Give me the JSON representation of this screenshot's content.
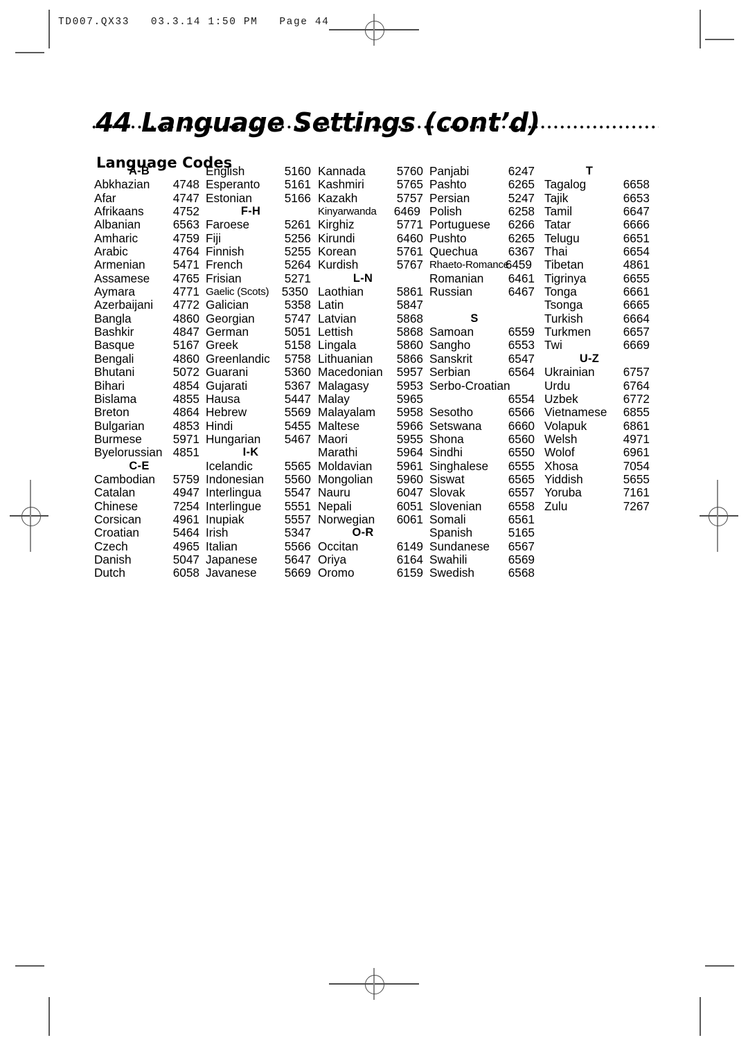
{
  "slug": "TD007.QX33   03.3.14 1:50 PM   Page 44",
  "page_number": "44",
  "title": "Language Settings (cont’d)",
  "section_title": "Language Codes",
  "columns": [
    {
      "id": "column-1",
      "rows": [
        {
          "type": "header",
          "label": "A-B"
        },
        {
          "type": "entry",
          "name": "Abkhazian",
          "code": "4748"
        },
        {
          "type": "entry",
          "name": "Afar",
          "code": "4747"
        },
        {
          "type": "entry",
          "name": "Afrikaans",
          "code": "4752"
        },
        {
          "type": "entry",
          "name": "Albanian",
          "code": "6563"
        },
        {
          "type": "entry",
          "name": "Amharic",
          "code": "4759"
        },
        {
          "type": "entry",
          "name": "Arabic",
          "code": "4764"
        },
        {
          "type": "entry",
          "name": "Armenian",
          "code": "5471"
        },
        {
          "type": "entry",
          "name": "Assamese",
          "code": "4765"
        },
        {
          "type": "entry",
          "name": "Aymara",
          "code": "4771"
        },
        {
          "type": "entry",
          "name": "Azerbaijani",
          "code": "4772"
        },
        {
          "type": "entry",
          "name": "Bangla",
          "code": "4860"
        },
        {
          "type": "entry",
          "name": "Bashkir",
          "code": "4847"
        },
        {
          "type": "entry",
          "name": "Basque",
          "code": "5167"
        },
        {
          "type": "entry",
          "name": "Bengali",
          "code": "4860"
        },
        {
          "type": "entry",
          "name": "Bhutani",
          "code": "5072"
        },
        {
          "type": "entry",
          "name": "Bihari",
          "code": "4854"
        },
        {
          "type": "entry",
          "name": "Bislama",
          "code": "4855"
        },
        {
          "type": "entry",
          "name": "Breton",
          "code": "4864"
        },
        {
          "type": "entry",
          "name": "Bulgarian",
          "code": "4853"
        },
        {
          "type": "entry",
          "name": "Burmese",
          "code": "5971"
        },
        {
          "type": "entry",
          "name": "Byelorussian",
          "code": "4851"
        },
        {
          "type": "header",
          "label": "C-E"
        },
        {
          "type": "entry",
          "name": "Cambodian",
          "code": "5759"
        },
        {
          "type": "entry",
          "name": "Catalan",
          "code": "4947"
        },
        {
          "type": "entry",
          "name": "Chinese",
          "code": "7254"
        },
        {
          "type": "entry",
          "name": "Corsican",
          "code": "4961"
        },
        {
          "type": "entry",
          "name": "Croatian",
          "code": "5464"
        },
        {
          "type": "entry",
          "name": "Czech",
          "code": "4965"
        },
        {
          "type": "entry",
          "name": "Danish",
          "code": "5047"
        },
        {
          "type": "entry",
          "name": "Dutch",
          "code": "6058"
        }
      ]
    },
    {
      "id": "column-2",
      "rows": [
        {
          "type": "entry",
          "name": "English",
          "code": "5160"
        },
        {
          "type": "entry",
          "name": "Esperanto",
          "code": "5161"
        },
        {
          "type": "entry",
          "name": "Estonian",
          "code": "5166"
        },
        {
          "type": "header",
          "label": "F-H"
        },
        {
          "type": "entry",
          "name": "Faroese",
          "code": "5261"
        },
        {
          "type": "entry",
          "name": "Fiji",
          "code": "5256"
        },
        {
          "type": "entry",
          "name": "Finnish",
          "code": "5255"
        },
        {
          "type": "entry",
          "name": "French",
          "code": "5264"
        },
        {
          "type": "entry",
          "name": "Frisian",
          "code": "5271"
        },
        {
          "type": "entry",
          "name": "Gaelic (Scots)",
          "code": "5350",
          "tight": true
        },
        {
          "type": "entry",
          "name": "Galician",
          "code": "5358"
        },
        {
          "type": "entry",
          "name": "Georgian",
          "code": "5747"
        },
        {
          "type": "entry",
          "name": "German",
          "code": "5051"
        },
        {
          "type": "entry",
          "name": "Greek",
          "code": "5158"
        },
        {
          "type": "entry",
          "name": "Greenlandic",
          "code": "5758"
        },
        {
          "type": "entry",
          "name": "Guarani",
          "code": "5360"
        },
        {
          "type": "entry",
          "name": "Gujarati",
          "code": "5367"
        },
        {
          "type": "entry",
          "name": "Hausa",
          "code": "5447"
        },
        {
          "type": "entry",
          "name": "Hebrew",
          "code": "5569"
        },
        {
          "type": "entry",
          "name": "Hindi",
          "code": "5455"
        },
        {
          "type": "entry",
          "name": "Hungarian",
          "code": "5467"
        },
        {
          "type": "header",
          "label": "I-K"
        },
        {
          "type": "entry",
          "name": "Icelandic",
          "code": "5565"
        },
        {
          "type": "entry",
          "name": "Indonesian",
          "code": "5560"
        },
        {
          "type": "entry",
          "name": "Interlingua",
          "code": "5547"
        },
        {
          "type": "entry",
          "name": "Interlingue",
          "code": "5551"
        },
        {
          "type": "entry",
          "name": "Inupiak",
          "code": "5557"
        },
        {
          "type": "entry",
          "name": "Irish",
          "code": "5347"
        },
        {
          "type": "entry",
          "name": "Italian",
          "code": "5566"
        },
        {
          "type": "entry",
          "name": "Japanese",
          "code": "5647"
        },
        {
          "type": "entry",
          "name": "Javanese",
          "code": "5669"
        }
      ]
    },
    {
      "id": "column-3",
      "rows": [
        {
          "type": "entry",
          "name": "Kannada",
          "code": "5760"
        },
        {
          "type": "entry",
          "name": "Kashmiri",
          "code": "5765"
        },
        {
          "type": "entry",
          "name": "Kazakh",
          "code": "5757"
        },
        {
          "type": "entry",
          "name": "Kinyarwanda",
          "code": "6469",
          "tight": true
        },
        {
          "type": "entry",
          "name": "Kirghiz",
          "code": "5771"
        },
        {
          "type": "entry",
          "name": "Kirundi",
          "code": "6460"
        },
        {
          "type": "entry",
          "name": "Korean",
          "code": "5761"
        },
        {
          "type": "entry",
          "name": "Kurdish",
          "code": "5767"
        },
        {
          "type": "header",
          "label": "L-N"
        },
        {
          "type": "entry",
          "name": "Laothian",
          "code": "5861"
        },
        {
          "type": "entry",
          "name": "Latin",
          "code": "5847"
        },
        {
          "type": "entry",
          "name": "Latvian",
          "code": "5868"
        },
        {
          "type": "entry",
          "name": "Lettish",
          "code": "5868"
        },
        {
          "type": "entry",
          "name": "Lingala",
          "code": "5860"
        },
        {
          "type": "entry",
          "name": "Lithuanian",
          "code": "5866"
        },
        {
          "type": "entry",
          "name": "Macedonian",
          "code": "5957"
        },
        {
          "type": "entry",
          "name": "Malagasy",
          "code": "5953"
        },
        {
          "type": "entry",
          "name": "Malay",
          "code": "5965"
        },
        {
          "type": "entry",
          "name": "Malayalam",
          "code": "5958"
        },
        {
          "type": "entry",
          "name": "Maltese",
          "code": "5966"
        },
        {
          "type": "entry",
          "name": "Maori",
          "code": "5955"
        },
        {
          "type": "entry",
          "name": "Marathi",
          "code": "5964"
        },
        {
          "type": "entry",
          "name": "Moldavian",
          "code": "5961"
        },
        {
          "type": "entry",
          "name": "Mongolian",
          "code": "5960"
        },
        {
          "type": "entry",
          "name": "Nauru",
          "code": "6047"
        },
        {
          "type": "entry",
          "name": "Nepali",
          "code": "6051"
        },
        {
          "type": "entry",
          "name": "Norwegian",
          "code": "6061"
        },
        {
          "type": "header",
          "label": "O-R"
        },
        {
          "type": "entry",
          "name": "Occitan",
          "code": "6149"
        },
        {
          "type": "entry",
          "name": "Oriya",
          "code": "6164"
        },
        {
          "type": "entry",
          "name": "Oromo",
          "code": "6159"
        }
      ]
    },
    {
      "id": "column-4",
      "rows": [
        {
          "type": "entry",
          "name": "Panjabi",
          "code": "6247"
        },
        {
          "type": "entry",
          "name": "Pashto",
          "code": "6265"
        },
        {
          "type": "entry",
          "name": "Persian",
          "code": "5247"
        },
        {
          "type": "entry",
          "name": "Polish",
          "code": "6258"
        },
        {
          "type": "entry",
          "name": "Portuguese",
          "code": "6266"
        },
        {
          "type": "entry",
          "name": "Pushto",
          "code": "6265"
        },
        {
          "type": "entry",
          "name": "Quechua",
          "code": "6367"
        },
        {
          "type": "entry",
          "name": "Rhaeto-Romance",
          "code": "6459",
          "tight": true
        },
        {
          "type": "entry",
          "name": "Romanian",
          "code": "6461"
        },
        {
          "type": "entry",
          "name": "Russian",
          "code": "6467"
        },
        {
          "type": "blank"
        },
        {
          "type": "header",
          "label": "S"
        },
        {
          "type": "entry",
          "name": "Samoan",
          "code": "6559"
        },
        {
          "type": "entry",
          "name": "Sangho",
          "code": "6553"
        },
        {
          "type": "entry",
          "name": "Sanskrit",
          "code": "6547"
        },
        {
          "type": "entry",
          "name": "Serbian",
          "code": "6564"
        },
        {
          "type": "entry",
          "name": "Serbo-Croatian",
          "code": ""
        },
        {
          "type": "entry",
          "name": "",
          "code": "6554"
        },
        {
          "type": "entry",
          "name": "Sesotho",
          "code": "6566"
        },
        {
          "type": "entry",
          "name": "Setswana",
          "code": "6660"
        },
        {
          "type": "entry",
          "name": "Shona",
          "code": "6560"
        },
        {
          "type": "entry",
          "name": "Sindhi",
          "code": "6550"
        },
        {
          "type": "entry",
          "name": "Singhalese",
          "code": "6555"
        },
        {
          "type": "entry",
          "name": "Siswat",
          "code": "6565"
        },
        {
          "type": "entry",
          "name": "Slovak",
          "code": "6557"
        },
        {
          "type": "entry",
          "name": "Slovenian",
          "code": "6558"
        },
        {
          "type": "entry",
          "name": "Somali",
          "code": "6561"
        },
        {
          "type": "entry",
          "name": "Spanish",
          "code": "5165"
        },
        {
          "type": "entry",
          "name": "Sundanese",
          "code": "6567"
        },
        {
          "type": "entry",
          "name": "Swahili",
          "code": "6569"
        },
        {
          "type": "entry",
          "name": "Swedish",
          "code": "6568"
        }
      ]
    },
    {
      "id": "column-5",
      "rows": [
        {
          "type": "header",
          "label": "T"
        },
        {
          "type": "entry",
          "name": "Tagalog",
          "code": "6658"
        },
        {
          "type": "entry",
          "name": "Tajik",
          "code": "6653"
        },
        {
          "type": "entry",
          "name": "Tamil",
          "code": "6647"
        },
        {
          "type": "entry",
          "name": "Tatar",
          "code": "6666"
        },
        {
          "type": "entry",
          "name": "Telugu",
          "code": "6651"
        },
        {
          "type": "entry",
          "name": "Thai",
          "code": "6654"
        },
        {
          "type": "entry",
          "name": "Tibetan",
          "code": "4861"
        },
        {
          "type": "entry",
          "name": "Tigrinya",
          "code": "6655"
        },
        {
          "type": "entry",
          "name": "Tonga",
          "code": "6661"
        },
        {
          "type": "entry",
          "name": "Tsonga",
          "code": "6665"
        },
        {
          "type": "entry",
          "name": "Turkish",
          "code": "6664"
        },
        {
          "type": "entry",
          "name": "Turkmen",
          "code": "6657"
        },
        {
          "type": "entry",
          "name": "Twi",
          "code": "6669"
        },
        {
          "type": "header",
          "label": "U-Z"
        },
        {
          "type": "entry",
          "name": "Ukrainian",
          "code": "6757"
        },
        {
          "type": "entry",
          "name": "Urdu",
          "code": "6764"
        },
        {
          "type": "entry",
          "name": "Uzbek",
          "code": "6772"
        },
        {
          "type": "entry",
          "name": "Vietnamese",
          "code": "6855"
        },
        {
          "type": "entry",
          "name": "Volapuk",
          "code": "6861"
        },
        {
          "type": "entry",
          "name": "Welsh",
          "code": "4971"
        },
        {
          "type": "entry",
          "name": "Wolof",
          "code": "6961"
        },
        {
          "type": "entry",
          "name": "Xhosa",
          "code": "7054"
        },
        {
          "type": "entry",
          "name": "Yiddish",
          "code": "5655"
        },
        {
          "type": "entry",
          "name": "Yoruba",
          "code": "7161"
        },
        {
          "type": "entry",
          "name": "Zulu",
          "code": "7267"
        }
      ]
    }
  ]
}
